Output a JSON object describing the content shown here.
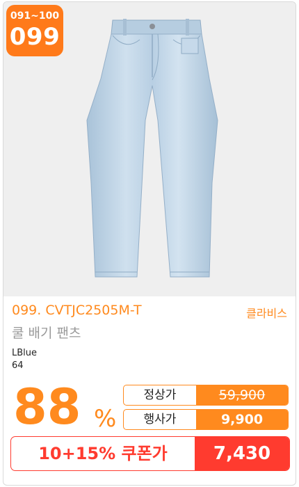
{
  "badge": {
    "range": "091~100",
    "number": "099"
  },
  "product": {
    "code_line": "099. CVTJC2505M-T",
    "brand": "클라비스",
    "name": "쿨 배기 팬츠",
    "color": "LBlue",
    "size": "64",
    "image_icon": "jeans-image"
  },
  "discount": {
    "value": "88",
    "unit": "%"
  },
  "prices": {
    "regular_label": "정상가",
    "regular_value": "59,900",
    "event_label": "행사가",
    "event_value": "9,900",
    "coupon_label": "10+15% 쿠폰가",
    "coupon_value": "7,430"
  },
  "colors": {
    "accent": "#ff8a1e",
    "badge": "#ff7a1a",
    "coupon": "#ff3b2f"
  }
}
